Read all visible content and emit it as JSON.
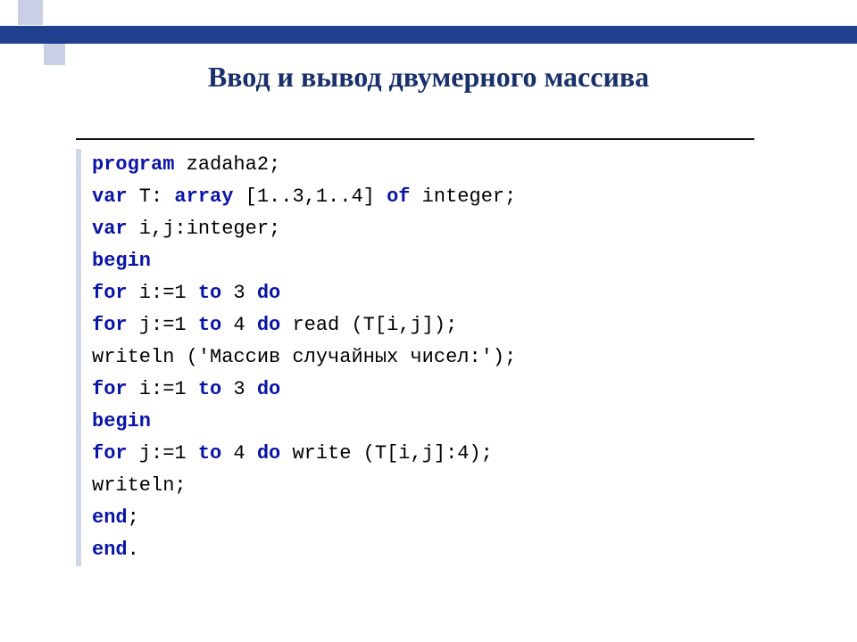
{
  "title": "Ввод и вывод двумерного массива",
  "code": {
    "kw_program": "program",
    "t_zadaha": " zadaha2;",
    "kw_var1": "var",
    "t_T": " T: ",
    "kw_array": "array",
    "t_dims": " [1..3,1..4] ",
    "kw_of": "of",
    "t_integer": " integer;",
    "kw_var2": "var",
    "t_ij": " i,j:integer;",
    "kw_begin1": "begin",
    "kw_for1": "for",
    "t_i1a": " i:=1 ",
    "kw_to1": "to",
    "t_i1b": " 3 ",
    "kw_do1": "do",
    "kw_for2": "for",
    "t_j1a": " j:=1 ",
    "kw_to2": "to",
    "t_j1b": " 4 ",
    "kw_do2": "do",
    "t_read": " read (T[i,j]);",
    "t_writeln1": "writeln ('Массив случайных чисел:');",
    "kw_for3": "for",
    "t_i2a": " i:=1 ",
    "kw_to3": "to",
    "t_i2b": " 3 ",
    "kw_do3": "do",
    "kw_begin2": "begin",
    "kw_for4": "for",
    "t_j2a": " j:=1 ",
    "kw_to4": "to",
    "t_j2b": " 4 ",
    "kw_do4": "do",
    "t_write": " write (T[i,j]:4);",
    "t_writeln2": "writeln;",
    "kw_end1": "end",
    "t_semi": ";",
    "kw_end2": "end",
    "t_dot": "."
  }
}
